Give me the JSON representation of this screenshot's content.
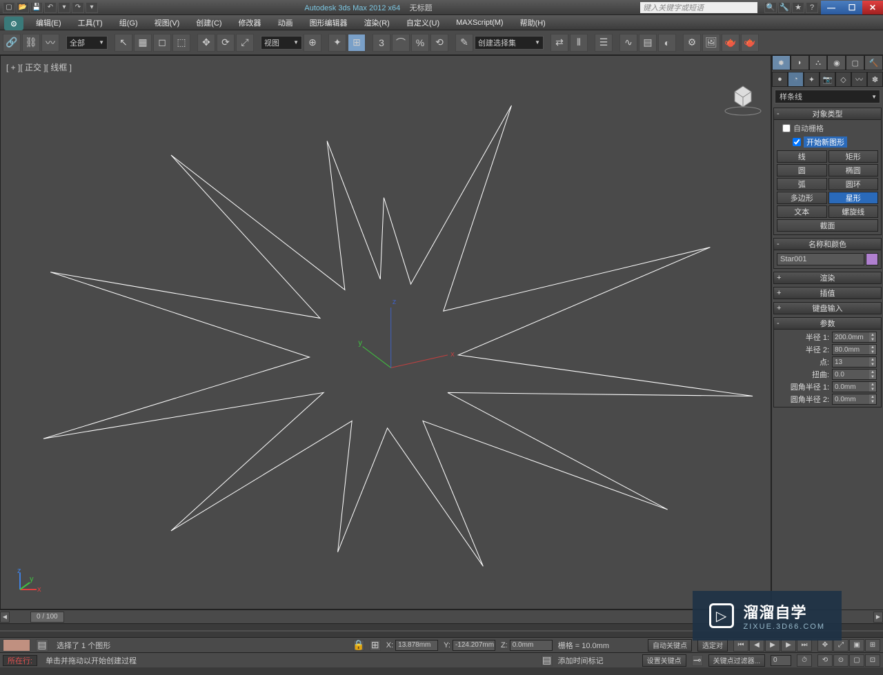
{
  "app": {
    "title": "Autodesk 3ds Max  2012 x64",
    "doc": "无标题",
    "search_placeholder": "键入关键字或短语"
  },
  "menu": {
    "edit": "编辑(E)",
    "tools": "工具(T)",
    "group": "组(G)",
    "views": "视图(V)",
    "create": "创建(C)",
    "modifiers": "修改器",
    "animation": "动画",
    "graph": "图形编辑器",
    "rendering": "渲染(R)",
    "customize": "自定义(U)",
    "maxscript": "MAXScript(M)",
    "help": "帮助(H)"
  },
  "toolbar": {
    "sel_filter": "全部",
    "view_shade": "视图",
    "named_set": "创建选择集"
  },
  "viewport": {
    "label": "[ + ][ 正交 ][ 线框 ]"
  },
  "panel": {
    "category": "样条线",
    "roll_objtype": "对象类型",
    "autogrid": "自动栅格",
    "startnew": "开始新图形",
    "shapes": {
      "line": "线",
      "rectangle": "矩形",
      "circle": "圆",
      "ellipse": "椭圆",
      "arc": "弧",
      "donut": "圆环",
      "ngon": "多边形",
      "star": "星形",
      "text": "文本",
      "helix": "螺旋线",
      "section": "截面"
    },
    "roll_name": "名称和颜色",
    "obj_name": "Star001",
    "roll_render": "渲染",
    "roll_interp": "插值",
    "roll_keyboard": "键盘输入",
    "roll_params": "参数",
    "params": {
      "radius1_label": "半径 1:",
      "radius1": "200.0mm",
      "radius2_label": "半径 2:",
      "radius2": "80.0mm",
      "points_label": "点:",
      "points": "13",
      "distortion_label": "扭曲:",
      "distortion": "0.0",
      "fillet1_label": "圆角半径 1:",
      "fillet1": "0.0mm",
      "fillet2_label": "圆角半径 2:",
      "fillet2": "0.0mm"
    }
  },
  "timeline": {
    "frame": "0 / 100"
  },
  "status": {
    "selection": "选择了 1 个图形",
    "prompt": "单击并拖动以开始创建过程",
    "x_label": "X:",
    "x": "13.878mm",
    "y_label": "Y:",
    "y": "-124.207mm",
    "z_label": "Z:",
    "z": "0.0mm",
    "grid": "栅格 = 10.0mm",
    "addtime": "添加时间标记",
    "autokey": "自动关键点",
    "setkey": "设置关键点",
    "selected": "选定对",
    "keyfilter": "关键点过滤器...",
    "cmd_label": "所在行:"
  },
  "watermark": {
    "brand": "溜溜自学",
    "url": "ZIXUE.3D66.COM"
  }
}
